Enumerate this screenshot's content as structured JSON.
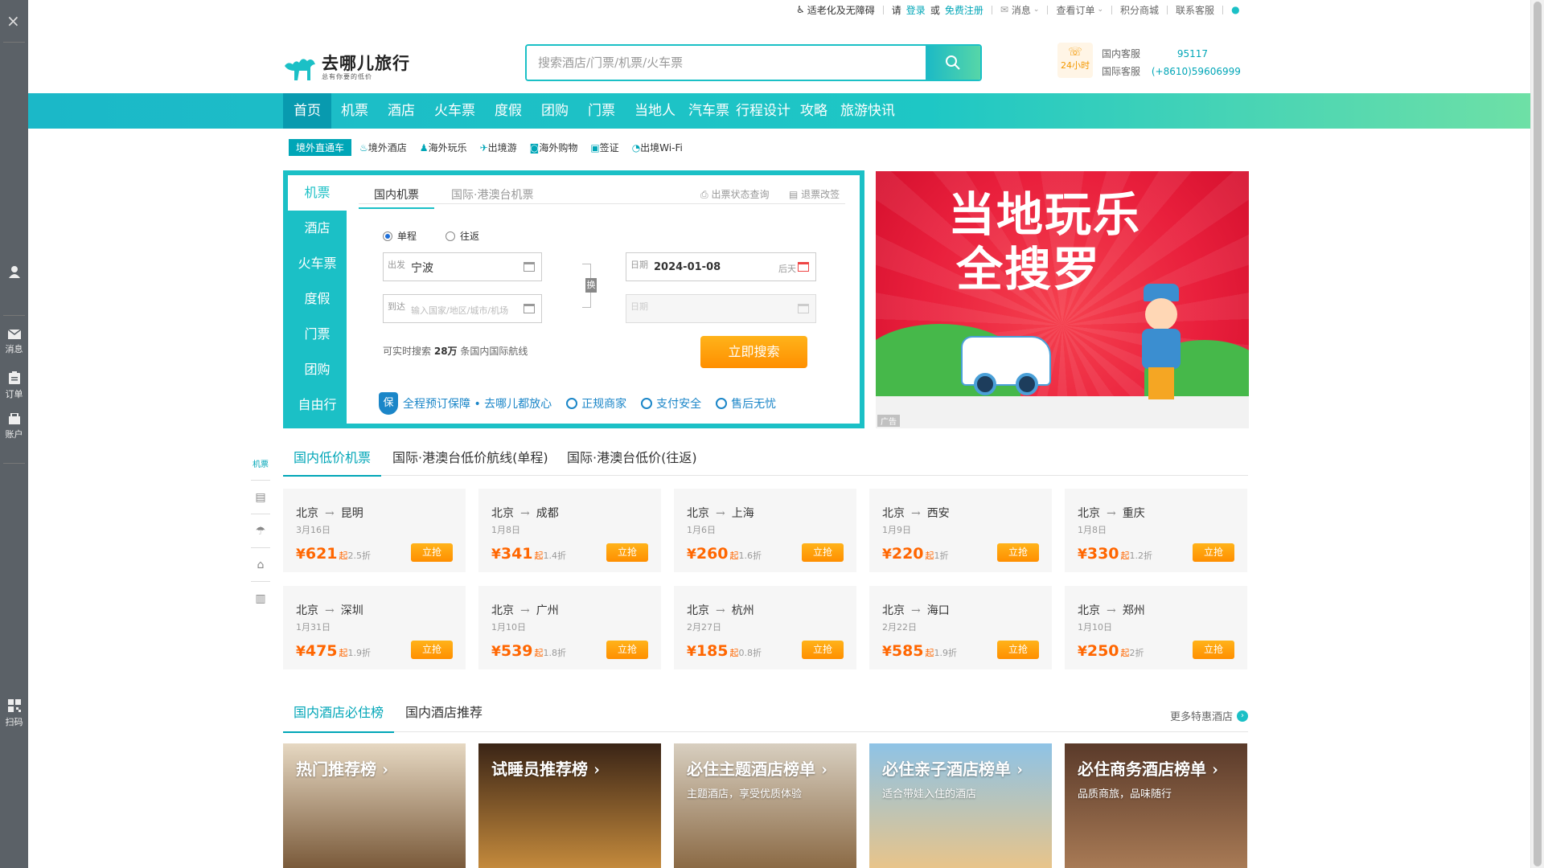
{
  "sidebar": {
    "close": "×",
    "items": [
      {
        "label": "",
        "icon": "user-icon"
      },
      {
        "label": "消息",
        "icon": "message-icon"
      },
      {
        "label": "订单",
        "icon": "order-icon"
      },
      {
        "label": "账户",
        "icon": "account-icon"
      },
      {
        "label": "扫码",
        "icon": "qrcode-icon"
      }
    ]
  },
  "topbar": {
    "accessibility": "适老化及无障碍",
    "please": "请",
    "login": "登录",
    "or": "或",
    "register": "免费注册",
    "messages": "消息",
    "orders": "查看订单",
    "points": "积分商城",
    "support": "联系客服"
  },
  "header": {
    "logo_name": "去哪儿旅行",
    "logo_slogan": "总有你要的低价",
    "search_placeholder": "搜索酒店/门票/机票/火车票",
    "badge": "24小时",
    "domestic_label": "国内客服",
    "domestic_number": "95117",
    "intl_label": "国际客服",
    "intl_number": "(+8610)59606999"
  },
  "nav": [
    "首页",
    "机票",
    "酒店",
    "火车票",
    "度假",
    "团购",
    "门票",
    "当地人",
    "汽车票",
    "行程设计",
    "攻略",
    "旅游快讯"
  ],
  "subnav": {
    "tag": "境外直通车",
    "items": [
      "境外酒店",
      "海外玩乐",
      "出境游",
      "海外购物",
      "签证",
      "出境Wi-Fi"
    ]
  },
  "booking": {
    "side_tabs": [
      "机票",
      "酒店",
      "火车票",
      "度假",
      "门票",
      "团购",
      "自由行"
    ],
    "tab_domestic": "国内机票",
    "tab_intl": "国际·港澳台机票",
    "link_status": "出票状态查询",
    "link_refund": "退票改签",
    "oneway": "单程",
    "roundtrip": "往返",
    "from_label": "出发",
    "from_value": "宁波",
    "to_label": "到达",
    "to_placeholder": "输入国家/地区/城市/机场",
    "date_label": "日期",
    "date_value": "2024-01-08",
    "date_hint": "后天",
    "date2_label": "日期",
    "swap": "换",
    "tip_prefix": "可实时搜索",
    "tip_count": "28万",
    "tip_suffix": "条国内国际航线",
    "search_btn": "立即搜索",
    "assurance": "全程预订保障 • 去哪儿都放心",
    "assure_items": [
      "正规商家",
      "支付安全",
      "售后无忧"
    ]
  },
  "ad": {
    "title_line1": "当地玩乐",
    "title_line2": "全搜罗",
    "tag": "广告"
  },
  "mini_nav": [
    "机票"
  ],
  "deals": {
    "tabs": [
      "国内低价机票",
      "国际·港澳台低价航线(单程)",
      "国际·港澳台低价(往返)"
    ],
    "currency": "¥",
    "qi": "起",
    "grab": "立抢",
    "cards": [
      {
        "from": "北京",
        "to": "昆明",
        "date": "3月16日",
        "price": "621",
        "disc": "2.5折"
      },
      {
        "from": "北京",
        "to": "成都",
        "date": "1月8日",
        "price": "341",
        "disc": "1.4折"
      },
      {
        "from": "北京",
        "to": "上海",
        "date": "1月6日",
        "price": "260",
        "disc": "1.6折"
      },
      {
        "from": "北京",
        "to": "西安",
        "date": "1月9日",
        "price": "220",
        "disc": "1折"
      },
      {
        "from": "北京",
        "to": "重庆",
        "date": "1月8日",
        "price": "330",
        "disc": "1.2折"
      },
      {
        "from": "北京",
        "to": "深圳",
        "date": "1月31日",
        "price": "475",
        "disc": "1.9折"
      },
      {
        "from": "北京",
        "to": "广州",
        "date": "1月10日",
        "price": "539",
        "disc": "1.8折"
      },
      {
        "from": "北京",
        "to": "杭州",
        "date": "2月27日",
        "price": "185",
        "disc": "0.8折"
      },
      {
        "from": "北京",
        "to": "海口",
        "date": "2月22日",
        "price": "585",
        "disc": "1.9折"
      },
      {
        "from": "北京",
        "to": "郑州",
        "date": "1月10日",
        "price": "250",
        "disc": "2折"
      }
    ]
  },
  "hotels": {
    "tabs": [
      "国内酒店必住榜",
      "国内酒店推荐"
    ],
    "more": "更多特惠酒店",
    "cards": [
      {
        "title": "热门推荐榜 ›",
        "sub": "",
        "bg1": "#e6d8c2",
        "bg2": "#7a5a3a"
      },
      {
        "title": "试睡员推荐榜 ›",
        "sub": "",
        "bg1": "#3a2416",
        "bg2": "#c48a3c"
      },
      {
        "title": "必住主题酒店榜单 ›",
        "sub": "主题酒店，享受优质体验",
        "bg1": "#d8cfc0",
        "bg2": "#8b6a45"
      },
      {
        "title": "必住亲子酒店榜单 ›",
        "sub": "适合带娃入住的酒店",
        "bg1": "#8ec3e6",
        "bg2": "#e8c48a"
      },
      {
        "title": "必住商务酒店榜单 ›",
        "sub": "品质商旅，品味随行",
        "bg1": "#5a3a2a",
        "bg2": "#a87a55"
      }
    ]
  }
}
